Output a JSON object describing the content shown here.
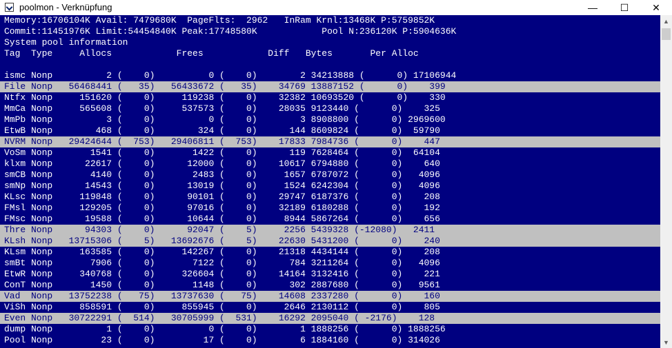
{
  "window": {
    "title": "poolmon - Verknüpfung",
    "minimize_glyph": "—",
    "maximize_glyph": "☐",
    "close_glyph": "✕",
    "icon": "console-app-icon"
  },
  "colors": {
    "background": "#000080",
    "text": "#ffffff",
    "highlight_background": "#c0c0c0",
    "highlight_text": "#000080"
  },
  "header": [
    "Memory:16706104K Avail: 7479680K  PageFlts:  2962   InRam Krnl:13468K P:5759852K",
    "Commit:11451976K Limit:54454840K Peak:17748580K            Pool N:236120K P:5904636K",
    "System pool information",
    "Tag  Type     Allocs            Frees            Diff   Bytes       Per Alloc",
    ""
  ],
  "rows": [
    {
      "text": "ismc Nonp          2 (    0)          0 (    0)        2 34213888 (      0) 17106944",
      "highlighted": false
    },
    {
      "text": "File Nonp   56468441 (   35)   56433672 (   35)    34769 13887152 (      0)    399",
      "highlighted": true
    },
    {
      "text": "Ntfx Nonp     151620 (    0)     119238 (    0)    32382 10693520 (      0)    330",
      "highlighted": false
    },
    {
      "text": "MmCa Nonp     565608 (    0)     537573 (    0)    28035 9123440 (      0)    325",
      "highlighted": false
    },
    {
      "text": "MmPb Nonp          3 (    0)          0 (    0)        3 8908800 (      0) 2969600",
      "highlighted": false
    },
    {
      "text": "EtwB Nonp        468 (    0)        324 (    0)      144 8609824 (      0)  59790",
      "highlighted": false
    },
    {
      "text": "NVRM Nonp   29424644 (  753)   29406811 (  753)    17833 7984736 (      0)    447",
      "highlighted": true
    },
    {
      "text": "VoSm Nonp       1541 (    0)       1422 (    0)      119 7628464 (      0)  64104",
      "highlighted": false
    },
    {
      "text": "klxm Nonp      22617 (    0)      12000 (    0)    10617 6794880 (      0)    640",
      "highlighted": false
    },
    {
      "text": "smCB Nonp       4140 (    0)       2483 (    0)     1657 6787072 (      0)   4096",
      "highlighted": false
    },
    {
      "text": "smNp Nonp      14543 (    0)      13019 (    0)     1524 6242304 (      0)   4096",
      "highlighted": false
    },
    {
      "text": "KLsc Nonp     119848 (    0)      90101 (    0)    29747 6187376 (      0)    208",
      "highlighted": false
    },
    {
      "text": "FMsl Nonp     129205 (    0)      97016 (    0)    32189 6180288 (      0)    192",
      "highlighted": false
    },
    {
      "text": "FMsc Nonp      19588 (    0)      10644 (    0)     8944 5867264 (      0)    656",
      "highlighted": false
    },
    {
      "text": "Thre Nonp      94303 (    0)      92047 (    5)     2256 5439328 (-12080)   2411",
      "highlighted": true
    },
    {
      "text": "KLsh Nonp   13715306 (    5)   13692676 (    5)    22630 5431200 (      0)    240",
      "highlighted": true
    },
    {
      "text": "KLsm Nonp     163585 (    0)     142267 (    0)    21318 4434144 (      0)    208",
      "highlighted": false
    },
    {
      "text": "smBt Nonp       7906 (    0)       7122 (    0)      784 3211264 (      0)   4096",
      "highlighted": false
    },
    {
      "text": "EtwR Nonp     340768 (    0)     326604 (    0)    14164 3132416 (      0)    221",
      "highlighted": false
    },
    {
      "text": "ConT Nonp       1450 (    0)       1148 (    0)      302 2887680 (      0)   9561",
      "highlighted": false
    },
    {
      "text": "Vad  Nonp   13752238 (   75)   13737630 (   75)    14608 2337280 (      0)    160",
      "highlighted": true
    },
    {
      "text": "ViSh Nonp     858591 (    0)     855945 (    0)     2646 2130112 (      0)    805",
      "highlighted": false
    },
    {
      "text": "Even Nonp   30722291 (  514)   30705999 (  531)    16292 2095040 ( -2176)    128",
      "highlighted": true
    },
    {
      "text": "dump Nonp          1 (    0)          0 (    0)        1 1888256 (      0) 1888256",
      "highlighted": false
    },
    {
      "text": "Pool Nonp         23 (    0)         17 (    0)        6 1884160 (      0) 314026",
      "highlighted": false
    }
  ],
  "scrollbar": {
    "up_glyph": "▲",
    "down_glyph": "▼"
  }
}
